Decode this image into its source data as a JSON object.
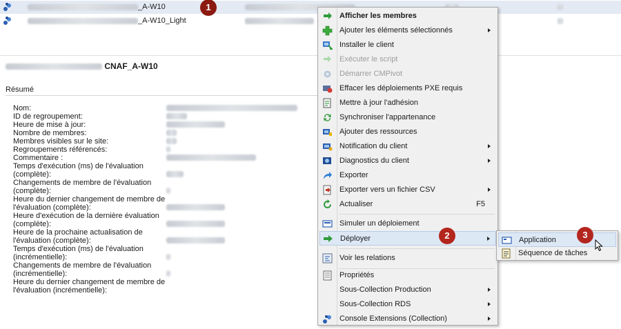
{
  "collections": [
    {
      "name_suffix": "_A-W10",
      "selected": true
    },
    {
      "name_suffix": "_A-W10_Light",
      "selected": false
    }
  ],
  "details": {
    "title_suffix": "CNAF_A-W10",
    "section": "Résumé",
    "properties": [
      "Nom:",
      "ID de regroupement:",
      "Heure de mise à jour:",
      "Nombre de membres:",
      "Membres visibles sur le site:",
      "Regroupements référencés:",
      "Commentaire :",
      "Temps d'exécution (ms) de l'évaluation",
      "(complète):",
      "Changements de membre de l'évaluation",
      "(complète):",
      "Heure du dernier changement de membre de",
      "l'évaluation (complète):",
      "Heure d'exécution de la dernière évaluation",
      "(complète):",
      "Heure de la prochaine actualisation de",
      "l'évaluation (complète):",
      "Temps d'exécution (ms) de l'évaluation",
      "(incrémentielle):",
      "Changements de membre de l'évaluation",
      "(incrémentielle):",
      "Heure du dernier changement de membre de",
      "l'évaluation (incrémentielle):"
    ]
  },
  "context_menu": {
    "items": [
      {
        "label": "Afficher les membres",
        "icon": "green-arrow-icon",
        "bold": true
      },
      {
        "label": "Ajouter les éléments sélectionnés",
        "icon": "green-plus-icon",
        "submenu": true
      },
      {
        "label": "Installer le client",
        "icon": "install-client-icon"
      },
      {
        "label": "Exécuter le script",
        "icon": "script-icon",
        "disabled": true
      },
      {
        "label": "Démarrer CMPivot",
        "icon": "cmpivot-icon",
        "disabled": true
      },
      {
        "label": "Effacer les déploiements PXE requis",
        "icon": "pxe-icon"
      },
      {
        "label": "Mettre à jour l'adhésion",
        "icon": "update-membership-icon"
      },
      {
        "label": "Synchroniser l'appartenance",
        "icon": "sync-icon"
      },
      {
        "label": "Ajouter des ressources",
        "icon": "add-resources-icon"
      },
      {
        "label": "Notification du client",
        "icon": "client-notification-icon",
        "submenu": true
      },
      {
        "label": "Diagnostics du client",
        "icon": "diagnostics-icon",
        "submenu": true
      },
      {
        "label": "Exporter",
        "icon": "export-icon"
      },
      {
        "label": "Exporter vers un fichier CSV",
        "icon": "csv-icon",
        "submenu": true
      },
      {
        "label": "Actualiser",
        "icon": "refresh-icon",
        "shortcut": "F5"
      },
      {
        "label": "Simuler un déploiement",
        "icon": "simulate-icon"
      },
      {
        "label": "Déployer",
        "icon": "deploy-arrow-icon",
        "submenu": true,
        "highlight": true
      },
      {
        "label": "Voir les relations",
        "icon": "relations-icon"
      },
      {
        "label": "Propriétés",
        "icon": "properties-icon"
      },
      {
        "label": "Sous-Collection Production",
        "icon": "",
        "submenu": true
      },
      {
        "label": "Sous-Collection RDS",
        "icon": "",
        "submenu": true
      },
      {
        "label": "Console Extensions (Collection)",
        "icon": "console-extensions-icon",
        "submenu": true
      }
    ]
  },
  "deploy_submenu": {
    "items": [
      {
        "label": "Application",
        "icon": "application-icon",
        "highlight": true
      },
      {
        "label": "Séquence de tâches",
        "icon": "task-sequence-icon"
      }
    ]
  },
  "badges": [
    "1",
    "2",
    "3"
  ]
}
